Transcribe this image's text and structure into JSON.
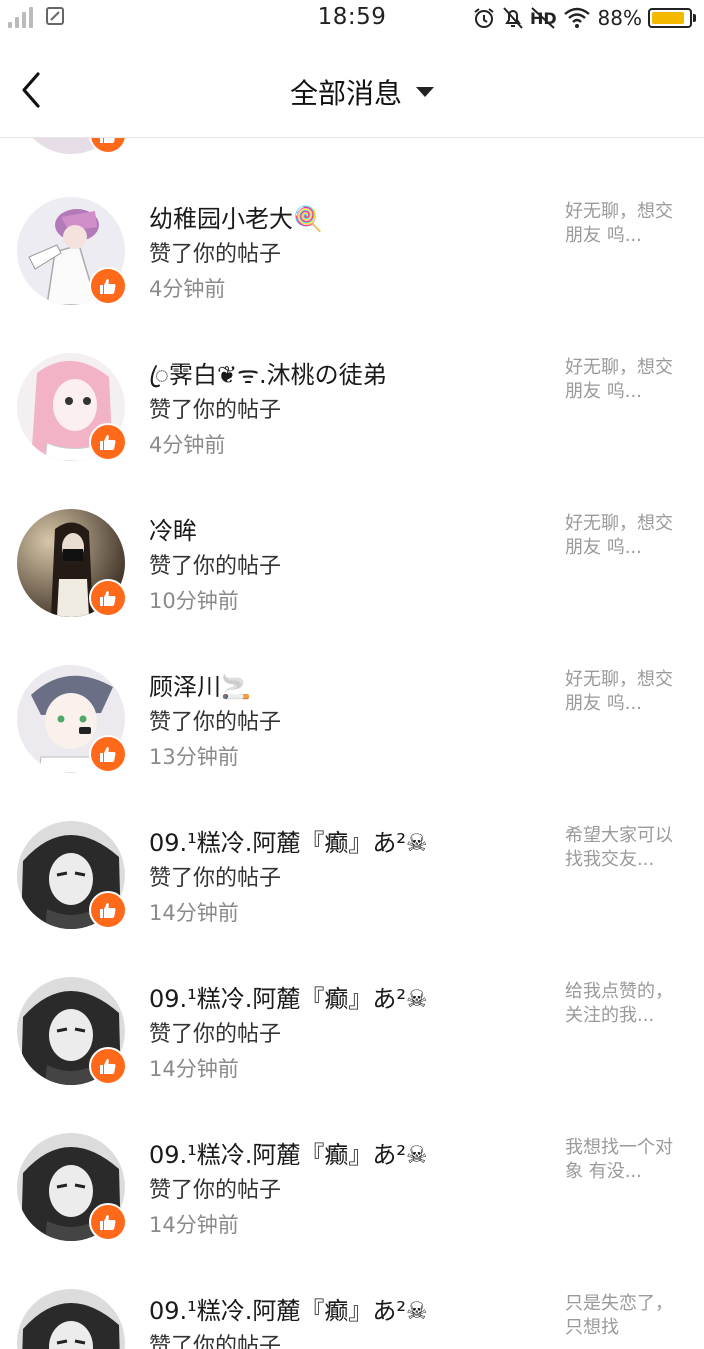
{
  "status_bar": {
    "time": "18:59",
    "battery_percent": "88%",
    "battery_level": 0.88,
    "icons": [
      "signal-icon",
      "sim-icon",
      "alarm-icon",
      "mute-icon",
      "nfc-icon",
      "wifi-icon",
      "battery-icon"
    ]
  },
  "nav": {
    "title": "全部消息",
    "back_icon": "chevron-left-icon",
    "dropdown_icon": "caret-down-icon"
  },
  "notifications": [
    {
      "name": "幼稚园小老大🍭",
      "action": "赞了你的帖子",
      "time": "4分钟前",
      "snippet": "好无聊，想交朋友 呜...",
      "avatar_color": "#c9b6d8"
    },
    {
      "name": "ꦿ霁白❦ᯤ.沐桃の徒弟",
      "action": "赞了你的帖子",
      "time": "4分钟前",
      "snippet": "好无聊，想交朋友 呜...",
      "avatar_color": "#f2b8c6"
    },
    {
      "name": "冷眸",
      "action": "赞了你的帖子",
      "time": "10分钟前",
      "snippet": "好无聊，想交朋友 呜...",
      "avatar_color": "#5a4a3c"
    },
    {
      "name": "顾泽川🚬",
      "action": "赞了你的帖子",
      "time": "13分钟前",
      "snippet": "好无聊，想交朋友 呜...",
      "avatar_color": "#e8e4ea"
    },
    {
      "name": "09.¹糕冷.阿麓『癫』あ²☠",
      "action": "赞了你的帖子",
      "time": "14分钟前",
      "snippet": "希望大家可以找我交友...",
      "avatar_color": "#3a3a3a"
    },
    {
      "name": "09.¹糕冷.阿麓『癫』あ²☠",
      "action": "赞了你的帖子",
      "time": "14分钟前",
      "snippet": "给我点赞的，关注的我...",
      "avatar_color": "#3a3a3a"
    },
    {
      "name": "09.¹糕冷.阿麓『癫』あ²☠",
      "action": "赞了你的帖子",
      "time": "14分钟前",
      "snippet": "我想找一个对象 有没...",
      "avatar_color": "#3a3a3a"
    },
    {
      "name": "09.¹糕冷.阿麓『癫』あ²☠",
      "action": "赞了你的帖子",
      "time": "",
      "snippet": "只是失恋了，只想找",
      "avatar_color": "#3a3a3a"
    }
  ],
  "colors": {
    "accent": "#ff6a1a",
    "battery": "#f5b800",
    "secondary_text": "#8a8a8a"
  }
}
